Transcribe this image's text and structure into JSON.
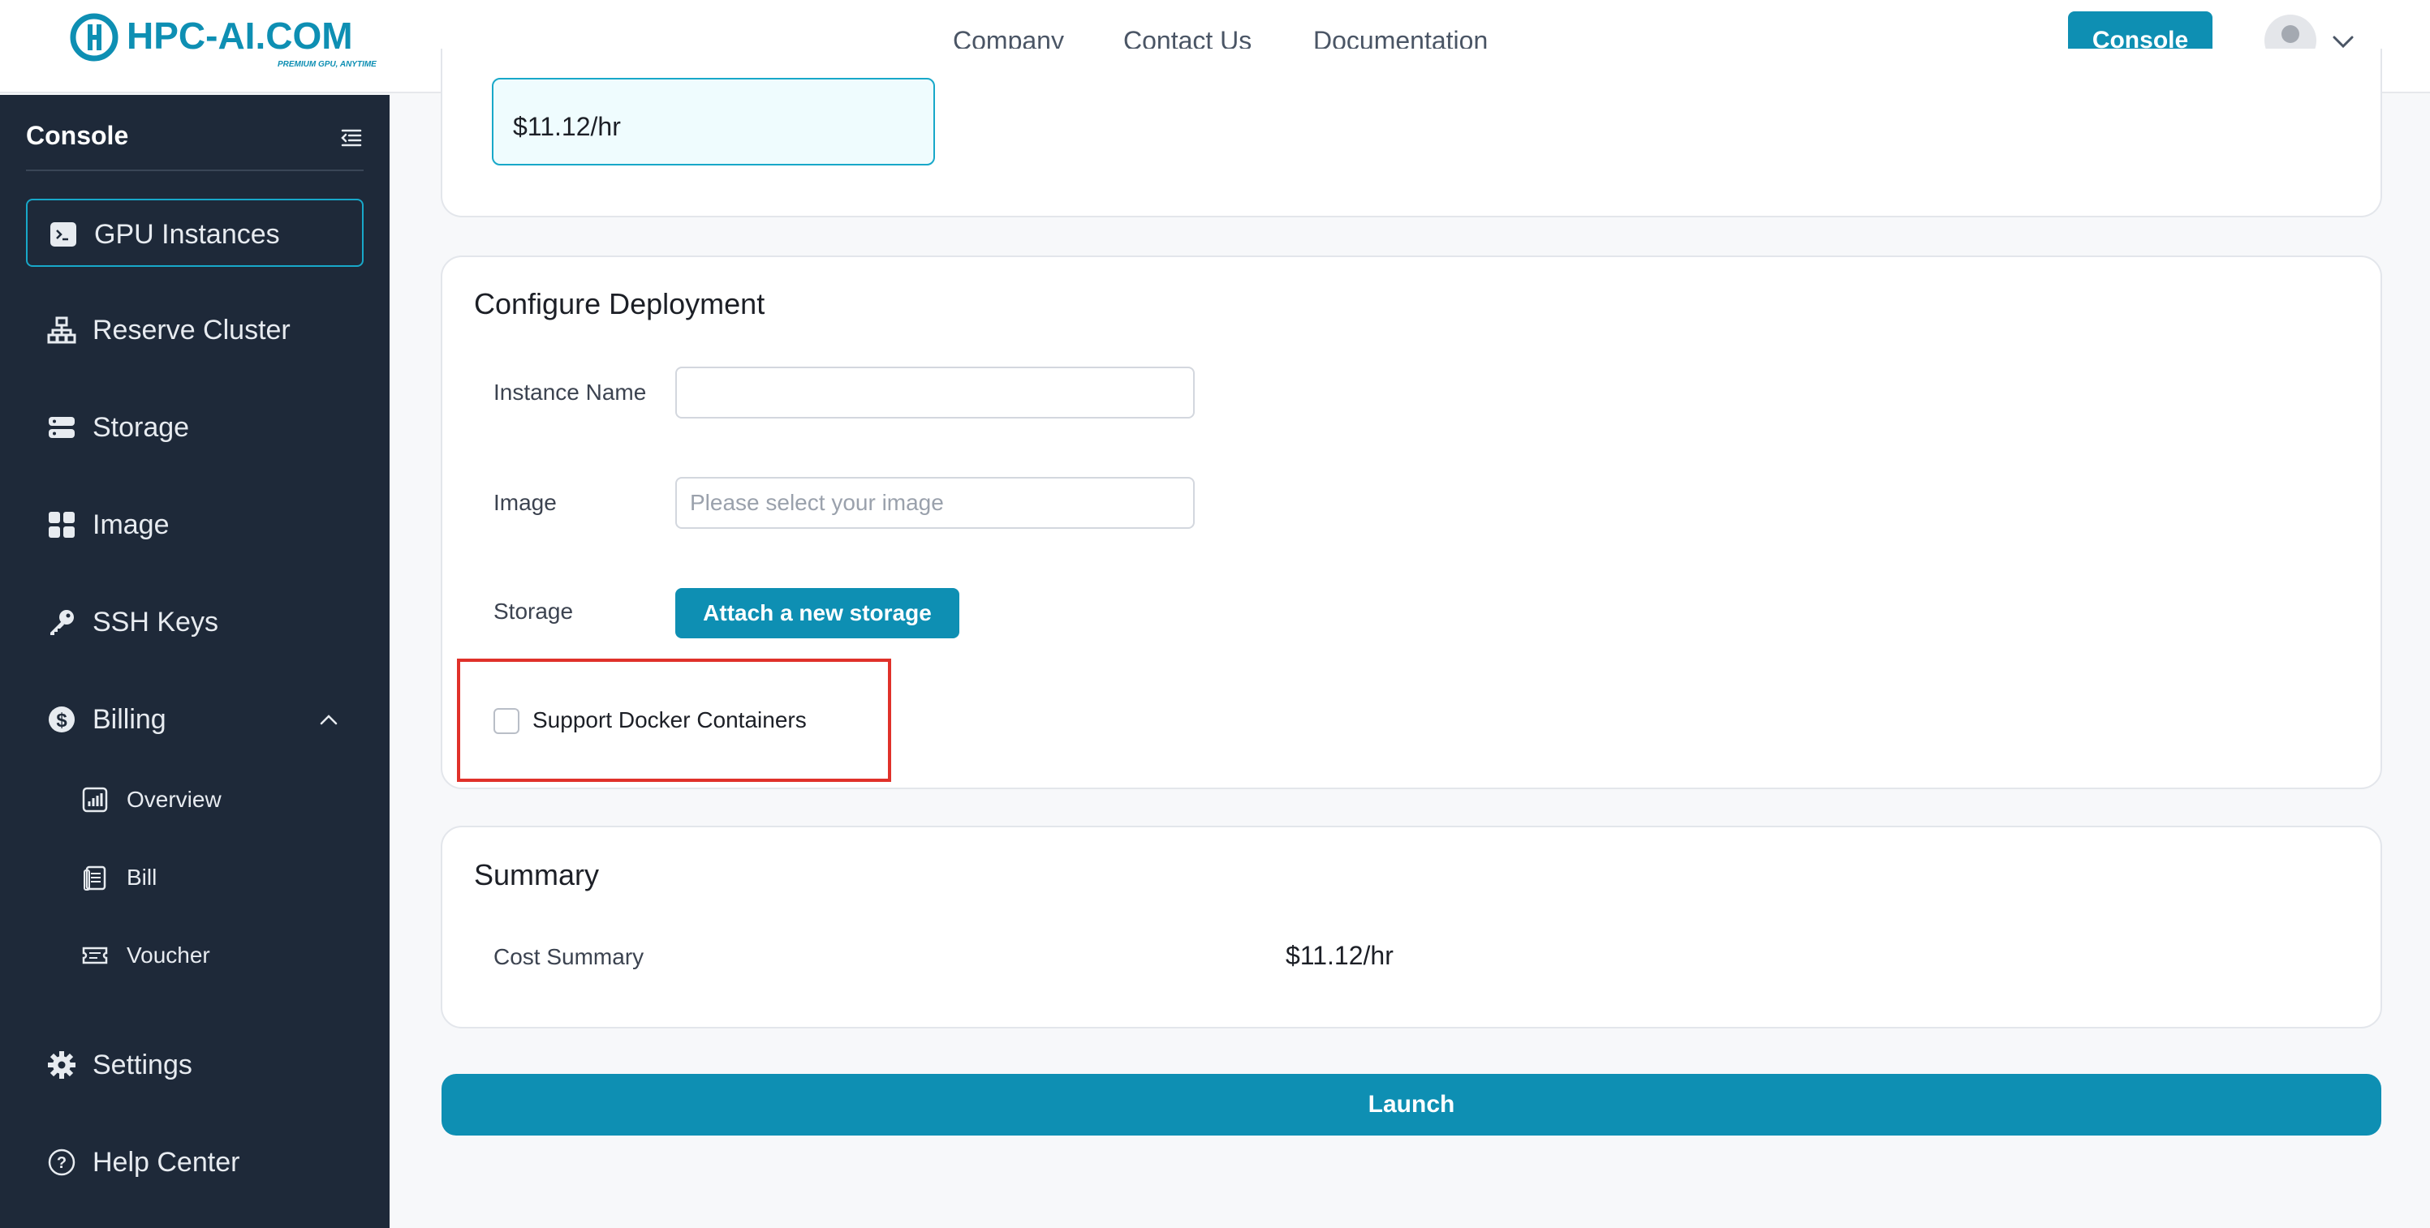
{
  "header": {
    "logo_text": "HPC-AI.COM",
    "logo_tagline": "PREMIUM GPU, ANYTIME",
    "nav": [
      "Company",
      "Contact Us",
      "Documentation"
    ],
    "console_button": "Console"
  },
  "sidebar": {
    "title": "Console",
    "items": [
      {
        "label": "GPU Instances",
        "icon": "terminal-icon",
        "active": true
      },
      {
        "label": "Reserve Cluster",
        "icon": "cluster-icon"
      },
      {
        "label": "Storage",
        "icon": "storage-icon"
      },
      {
        "label": "Image",
        "icon": "grid-icon"
      },
      {
        "label": "SSH Keys",
        "icon": "key-icon"
      },
      {
        "label": "Billing",
        "icon": "dollar-icon",
        "expanded": true
      },
      {
        "label": "Settings",
        "icon": "gear-icon"
      },
      {
        "label": "Help Center",
        "icon": "help-icon"
      }
    ],
    "billing_sub": [
      {
        "label": "Overview",
        "icon": "chart-icon"
      },
      {
        "label": "Bill",
        "icon": "clipboard-icon"
      },
      {
        "label": "Voucher",
        "icon": "ticket-icon"
      }
    ]
  },
  "main": {
    "selected_price": "$11.12/hr",
    "configure": {
      "title": "Configure Deployment",
      "instance_name_label": "Instance Name",
      "instance_name_value": "",
      "image_label": "Image",
      "image_placeholder": "Please select your image",
      "storage_label": "Storage",
      "attach_storage_button": "Attach a new storage",
      "docker_checkbox_label": "Support Docker Containers",
      "docker_checked": false
    },
    "summary": {
      "title": "Summary",
      "cost_label": "Cost Summary",
      "cost_value": "$11.12/hr"
    },
    "launch_button": "Launch"
  },
  "colors": {
    "accent": "#0e8fb3",
    "sidebar_bg": "#1e2939",
    "highlight": "#e0312a"
  }
}
